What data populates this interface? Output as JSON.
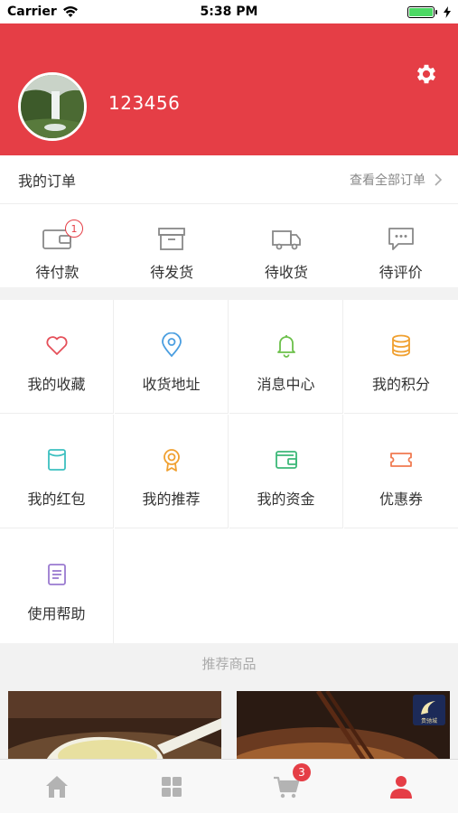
{
  "status_bar": {
    "carrier": "Carrier",
    "time": "5:38 PM"
  },
  "profile": {
    "username": "123456"
  },
  "orders": {
    "title": "我的订单",
    "view_all": "查看全部订单",
    "items": [
      {
        "label": "待付款",
        "icon": "wallet-icon",
        "badge": "1"
      },
      {
        "label": "待发货",
        "icon": "box-icon"
      },
      {
        "label": "待收货",
        "icon": "truck-icon"
      },
      {
        "label": "待评价",
        "icon": "comment-icon"
      }
    ]
  },
  "services": [
    {
      "label": "我的收藏",
      "icon": "heart-icon",
      "color": "#e5505a"
    },
    {
      "label": "收货地址",
      "icon": "location-pin-icon",
      "color": "#4a9ee0"
    },
    {
      "label": "消息中心",
      "icon": "bell-icon",
      "color": "#6cc04a"
    },
    {
      "label": "我的积分",
      "icon": "coins-icon",
      "color": "#f0a030"
    },
    {
      "label": "我的红包",
      "icon": "red-packet-icon",
      "color": "#3cc0c0"
    },
    {
      "label": "我的推荐",
      "icon": "medal-icon",
      "color": "#f0a030"
    },
    {
      "label": "我的资金",
      "icon": "wallet-icon",
      "color": "#3cb878"
    },
    {
      "label": "优惠券",
      "icon": "ticket-icon",
      "color": "#f07a50"
    },
    {
      "label": "使用帮助",
      "icon": "document-icon",
      "color": "#9a7ad0"
    }
  ],
  "recommend": {
    "title": "推荐商品",
    "logo_text": "贵驰城"
  },
  "tabbar": {
    "cart_badge": "3",
    "active": "profile"
  },
  "colors": {
    "brand": "#e53e46",
    "active_tab": "#e53e46",
    "inactive_tab": "#b3b3b3"
  }
}
